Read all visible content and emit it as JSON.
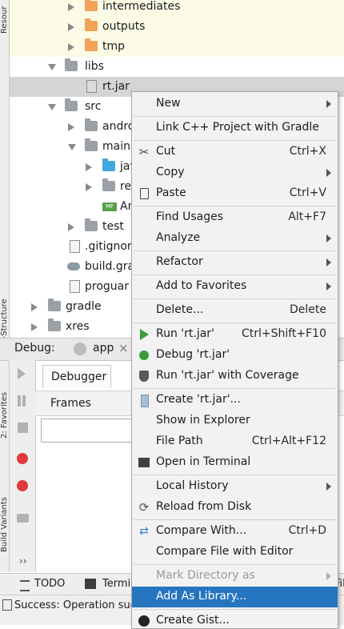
{
  "left_stripe": {
    "top_label": "Resour",
    "mid_label": "Z-Structure",
    "fav_label": "2: Favorites",
    "bv_label": "Build Variants"
  },
  "tree": {
    "items": [
      {
        "label": "intermediates"
      },
      {
        "label": "outputs"
      },
      {
        "label": "tmp"
      },
      {
        "label": "libs"
      },
      {
        "label": "rt.jar"
      },
      {
        "label": "src"
      },
      {
        "label": "andro"
      },
      {
        "label": "main"
      },
      {
        "label": "jav"
      },
      {
        "label": "re"
      },
      {
        "label": "An"
      },
      {
        "label": "test"
      },
      {
        "label": ".gitignor"
      },
      {
        "label": "build.gra"
      },
      {
        "label": "proguar"
      },
      {
        "label": "gradle"
      },
      {
        "label": "xres"
      }
    ]
  },
  "debug": {
    "label": "Debug:",
    "tab": "app",
    "close": "×",
    "debugger_tab": "Debugger",
    "frames": "Frames",
    "more": "››"
  },
  "bottom": {
    "todo": "TODO",
    "terminal": "Termi",
    "fil": "Fil"
  },
  "status": {
    "text": "Success: Operation suc"
  },
  "menu": {
    "new": {
      "label": "New"
    },
    "link_cpp": {
      "label": "Link C++ Project with Gradle"
    },
    "cut": {
      "label": "Cut",
      "shortcut": "Ctrl+X"
    },
    "copy": {
      "label": "Copy"
    },
    "paste": {
      "label": "Paste",
      "shortcut": "Ctrl+V"
    },
    "find_usages": {
      "label": "Find Usages",
      "shortcut": "Alt+F7"
    },
    "analyze": {
      "label": "Analyze"
    },
    "refactor": {
      "label": "Refactor"
    },
    "add_favorites": {
      "label": "Add to Favorites"
    },
    "delete": {
      "label": "Delete...",
      "shortcut": "Delete"
    },
    "run": {
      "label": "Run 'rt.jar'",
      "shortcut": "Ctrl+Shift+F10"
    },
    "debug": {
      "label": "Debug 'rt.jar'"
    },
    "run_coverage": {
      "label": "Run 'rt.jar' with Coverage"
    },
    "create": {
      "label": "Create 'rt.jar'..."
    },
    "show_explorer": {
      "label": "Show in Explorer"
    },
    "file_path": {
      "label": "File Path",
      "shortcut": "Ctrl+Alt+F12"
    },
    "open_terminal": {
      "label": "Open in Terminal"
    },
    "local_history": {
      "label": "Local History"
    },
    "reload": {
      "label": "Reload from Disk"
    },
    "compare_with": {
      "label": "Compare With...",
      "shortcut": "Ctrl+D"
    },
    "compare_editor": {
      "label": "Compare File with Editor"
    },
    "mark_dir": {
      "label": "Mark Directory as"
    },
    "add_library": {
      "label": "Add As Library..."
    },
    "create_gist": {
      "label": "Create Gist..."
    }
  },
  "colors": {
    "selection": "#2675bf",
    "folder": "#f0a258",
    "run_green": "#3b9c3b"
  }
}
